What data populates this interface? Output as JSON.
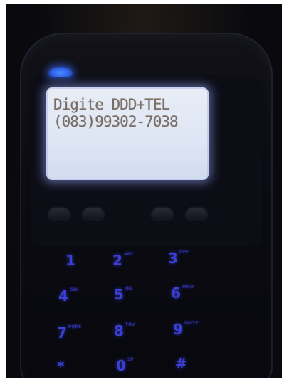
{
  "screen": {
    "line1": "Digite DDD+TEL",
    "line2": "(083)99302-7038"
  },
  "keypad": [
    {
      "num": "1",
      "sub": ""
    },
    {
      "num": "2",
      "sub": "ABC"
    },
    {
      "num": "3",
      "sub": "DEF"
    },
    {
      "num": "4",
      "sub": "GHI"
    },
    {
      "num": "5",
      "sub": "JKL"
    },
    {
      "num": "6",
      "sub": "MNO"
    },
    {
      "num": "7",
      "sub": "PQRS"
    },
    {
      "num": "8",
      "sub": "TUV"
    },
    {
      "num": "9",
      "sub": "WXYZ"
    },
    {
      "num": "*",
      "sub": ""
    },
    {
      "num": "0",
      "sub": "SP"
    },
    {
      "num": "#",
      "sub": ""
    }
  ],
  "colors": {
    "screen_backlight": "#dfe6f4",
    "screen_text": "#7a6e66",
    "key_glow": "#3b3fd8",
    "led": "#2c5fe6"
  }
}
